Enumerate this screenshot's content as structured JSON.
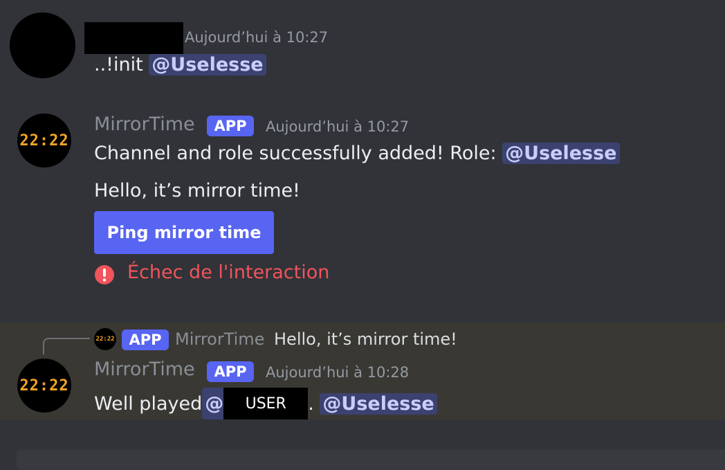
{
  "messages": [
    {
      "author_redacted": true,
      "timestamp": "Aujourd’hui à 10:27",
      "content_prefix": "..!init ",
      "mention": "@Uselesse"
    },
    {
      "author": "MirrorTime",
      "badge": "APP",
      "timestamp": "Aujourd’hui à 10:27",
      "avatar_text": "22:22",
      "line1_prefix": "Channel and role successfully added! Role: ",
      "line1_mention": "@Uselesse",
      "line2": "Hello, it’s mirror time!",
      "button_label": "Ping mirror time",
      "error_text": "Échec de l'interaction",
      "error_color": "#f0545c"
    },
    {
      "reply": {
        "avatar_text": "22:22",
        "badge": "APP",
        "author": "MirrorTime",
        "text": "Hello, it’s mirror time!"
      },
      "author": "MirrorTime",
      "badge": "APP",
      "timestamp": "Aujourd’hui à 10:28",
      "avatar_text": "22:22",
      "content_prefix": "Well played ",
      "mention_user_at": "@",
      "redacted_user": "USER",
      "separator": ". ",
      "mention": "@Uselesse"
    }
  ],
  "colors": {
    "background": "#313338",
    "highlight_row": "#3a3833",
    "accent": "#5865f2",
    "mention_bg": "#3c4270",
    "mention_fg": "#c9cdfb"
  }
}
